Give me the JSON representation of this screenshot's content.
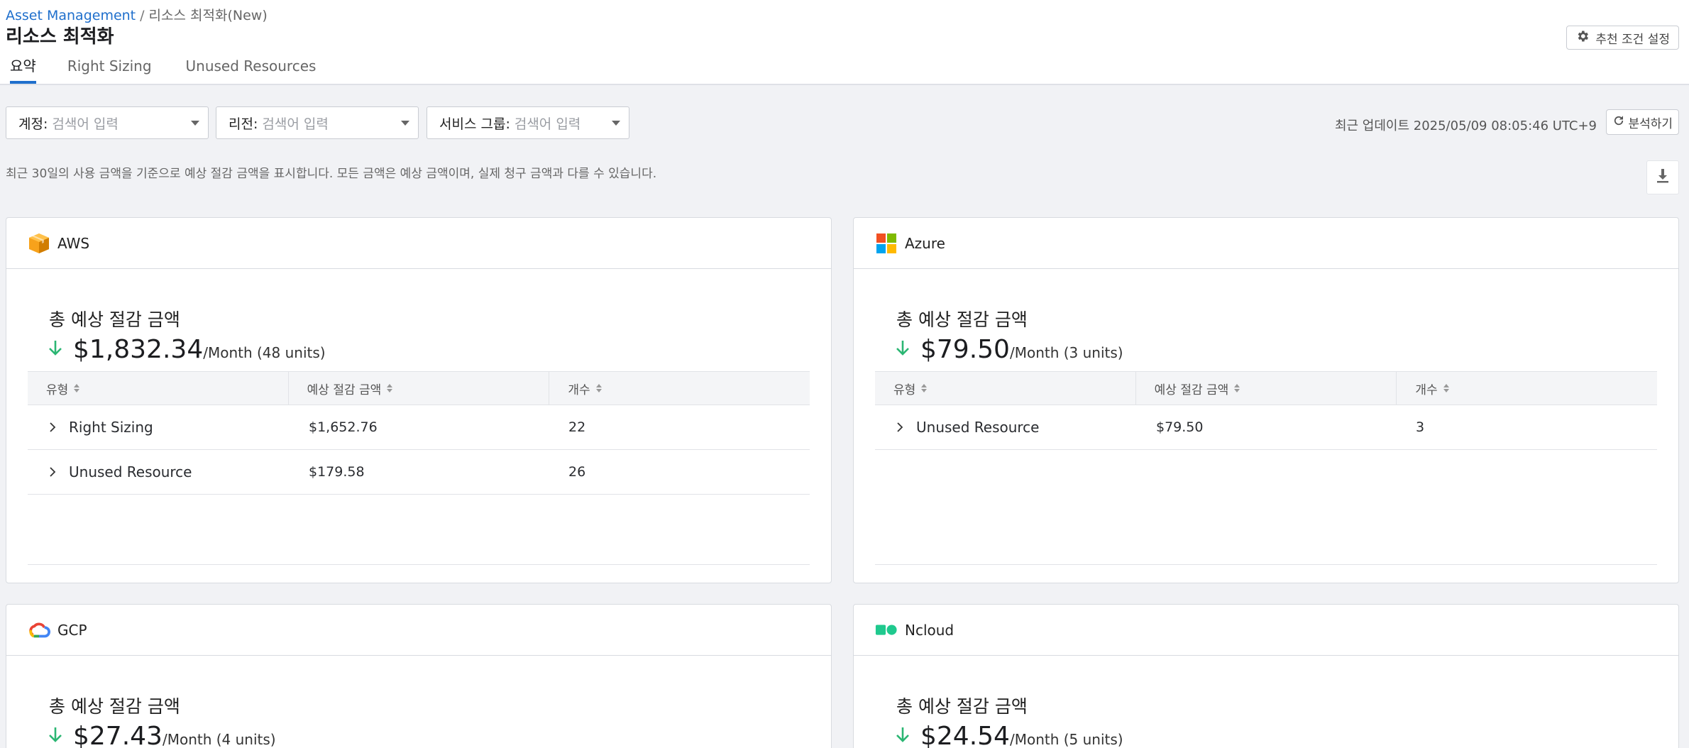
{
  "breadcrumb": {
    "root": "Asset Management",
    "separator": "/",
    "current": "리소스 최적화(New)"
  },
  "page_title": "리소스 최적화",
  "tabs": [
    {
      "label": "요약",
      "active": true
    },
    {
      "label": "Right Sizing",
      "active": false
    },
    {
      "label": "Unused Resources",
      "active": false
    }
  ],
  "settings_button": {
    "label": "추천 조건 설정",
    "icon": "gear-icon"
  },
  "filters": [
    {
      "label": "계정:",
      "placeholder": "검색어 입력"
    },
    {
      "label": "리전:",
      "placeholder": "검색어 입력"
    },
    {
      "label": "서비스 그룹:",
      "placeholder": "검색어 입력"
    }
  ],
  "last_updated": "최근 업데이트 2025/05/09 08:05:46 UTC+9",
  "analyze_button": {
    "label": "분석하기",
    "icon": "refresh-icon"
  },
  "notice": "최근 30일의 사용 금액을 기준으로 예상 절감 금액을 표시합니다. 모든 금액은 예상 금액이며, 실제 청구 금액과 다를 수 있습니다.",
  "download_icon": "download-icon",
  "colors": {
    "accent": "#1f6fcc",
    "down_arrow": "#2bb673",
    "aws": "#f7a21b",
    "ncloud": "#1fc98e"
  },
  "table_headers": [
    "유형",
    "예상 절감 금액",
    "개수"
  ],
  "cards": [
    {
      "provider": "AWS",
      "total_label": "총 예상 절감 금액",
      "total_amount": "$1,832.34",
      "total_suffix": "/Month (48 units)",
      "rows": [
        {
          "type": "Right Sizing",
          "amount": "$1,652.76",
          "count": "22"
        },
        {
          "type": "Unused Resource",
          "amount": "$179.58",
          "count": "26"
        }
      ]
    },
    {
      "provider": "Azure",
      "total_label": "총 예상 절감 금액",
      "total_amount": "$79.50",
      "total_suffix": "/Month (3 units)",
      "rows": [
        {
          "type": "Unused Resource",
          "amount": "$79.50",
          "count": "3"
        }
      ]
    },
    {
      "provider": "GCP",
      "total_label": "총 예상 절감 금액",
      "total_amount": "$27.43",
      "total_suffix": "/Month (4 units)",
      "rows": []
    },
    {
      "provider": "Ncloud",
      "total_label": "총 예상 절감 금액",
      "total_amount": "$24.54",
      "total_suffix": "/Month (5 units)",
      "rows": []
    }
  ]
}
